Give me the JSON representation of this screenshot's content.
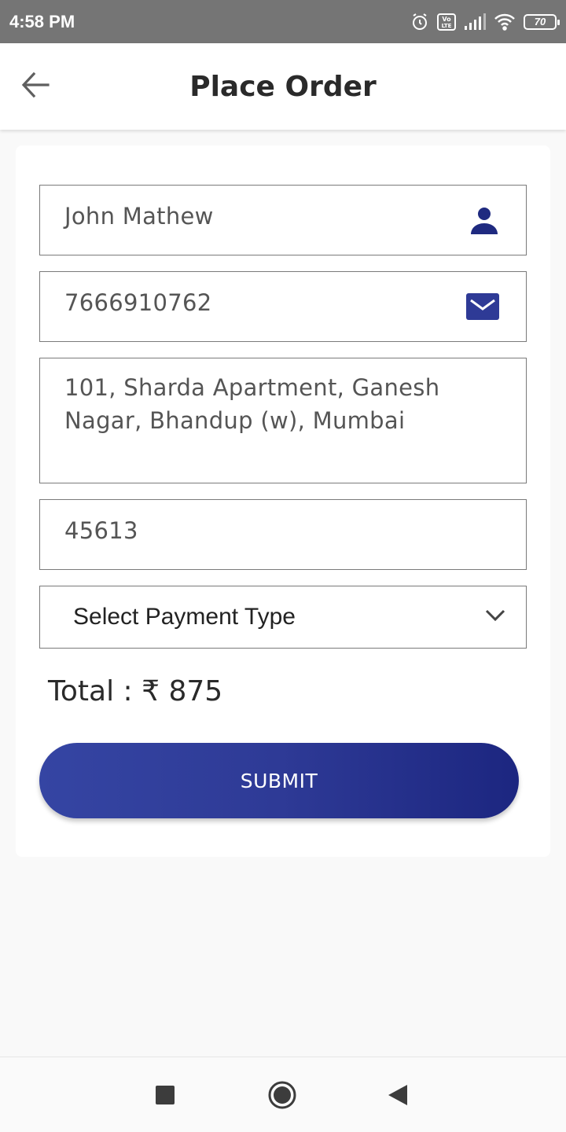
{
  "status_bar": {
    "time": "4:58 PM",
    "battery": "70",
    "icons": [
      "alarm-icon",
      "volte-icon",
      "signal-icon",
      "wifi-icon",
      "battery-icon"
    ]
  },
  "app_bar": {
    "title": "Place Order",
    "back_icon": "arrow-left-icon"
  },
  "form": {
    "name_value": "John Mathew",
    "name_icon": "person-icon",
    "phone_value": "7666910762",
    "phone_icon": "mail-icon",
    "address_value": "101, Sharda Apartment, Ganesh Nagar, Bhandup (w), Mumbai",
    "pincode_value": "45613",
    "payment_select_value": "Select Payment Type",
    "payment_select_icon": "chevron-down-icon"
  },
  "total_label": "Total : ₹ 875",
  "submit_label": "SUBMIT",
  "colors": {
    "accent": "#2e3a96",
    "icon": "#1f2a80",
    "status_bar": "#757575"
  },
  "nav_bar": {
    "buttons": [
      "recents-square-icon",
      "home-circle-icon",
      "back-triangle-icon"
    ]
  }
}
